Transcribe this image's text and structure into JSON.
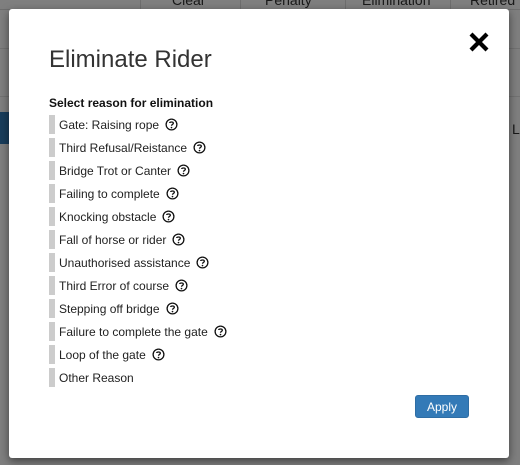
{
  "background": {
    "columns": [
      "Clear",
      "Penalty",
      "Elimination",
      "Retired"
    ],
    "right_letter": "L"
  },
  "modal": {
    "title": "Eliminate Rider",
    "close_icon": "close-icon",
    "select_label": "Select reason for elimination",
    "reasons": [
      {
        "label": "Gate: Raising rope",
        "help": true
      },
      {
        "label": "Third Refusal/Reistance",
        "help": true
      },
      {
        "label": "Bridge Trot or Canter",
        "help": true
      },
      {
        "label": "Failing to complete",
        "help": true
      },
      {
        "label": "Knocking obstacle",
        "help": true
      },
      {
        "label": "Fall of horse or rider",
        "help": true
      },
      {
        "label": "Unauthorised assistance",
        "help": true
      },
      {
        "label": "Third Error of course",
        "help": true
      },
      {
        "label": "Stepping off bridge",
        "help": true
      },
      {
        "label": "Failure to complete the gate",
        "help": true
      },
      {
        "label": "Loop of the gate",
        "help": true
      },
      {
        "label": "Other Reason",
        "help": false
      }
    ],
    "apply_label": "Apply",
    "colors": {
      "accent": "#337ab7",
      "option_bar": "#cccccc",
      "overlay": "rgba(0,0,0,0.5)"
    }
  }
}
